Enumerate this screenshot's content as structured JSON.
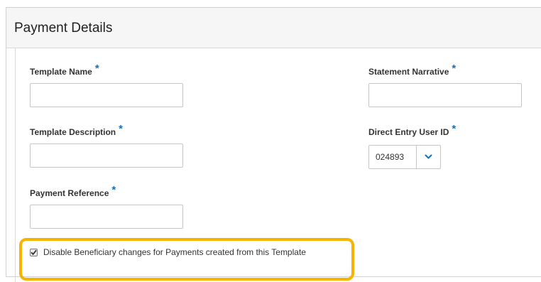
{
  "panel": {
    "title": "Payment Details"
  },
  "fields": {
    "template_name": {
      "label": "Template Name",
      "required": "*",
      "value": ""
    },
    "template_description": {
      "label": "Template Description",
      "required": "*",
      "value": ""
    },
    "payment_reference": {
      "label": "Payment Reference",
      "required": "*",
      "value": ""
    },
    "statement_narrative": {
      "label": "Statement Narrative",
      "required": "*",
      "value": ""
    },
    "direct_entry_user_id": {
      "label": "Direct Entry User ID",
      "required": "*",
      "selected": "024893"
    }
  },
  "checkbox": {
    "label": "Disable Beneficiary changes for Payments created from this Template",
    "checked": true
  },
  "colors": {
    "required_marker": "#1a6fb5",
    "highlight": "#f6b400",
    "chevron": "#1a6fb5"
  },
  "icons": {
    "dropdown": "chevron-down-icon",
    "check": "checkmark-icon"
  }
}
